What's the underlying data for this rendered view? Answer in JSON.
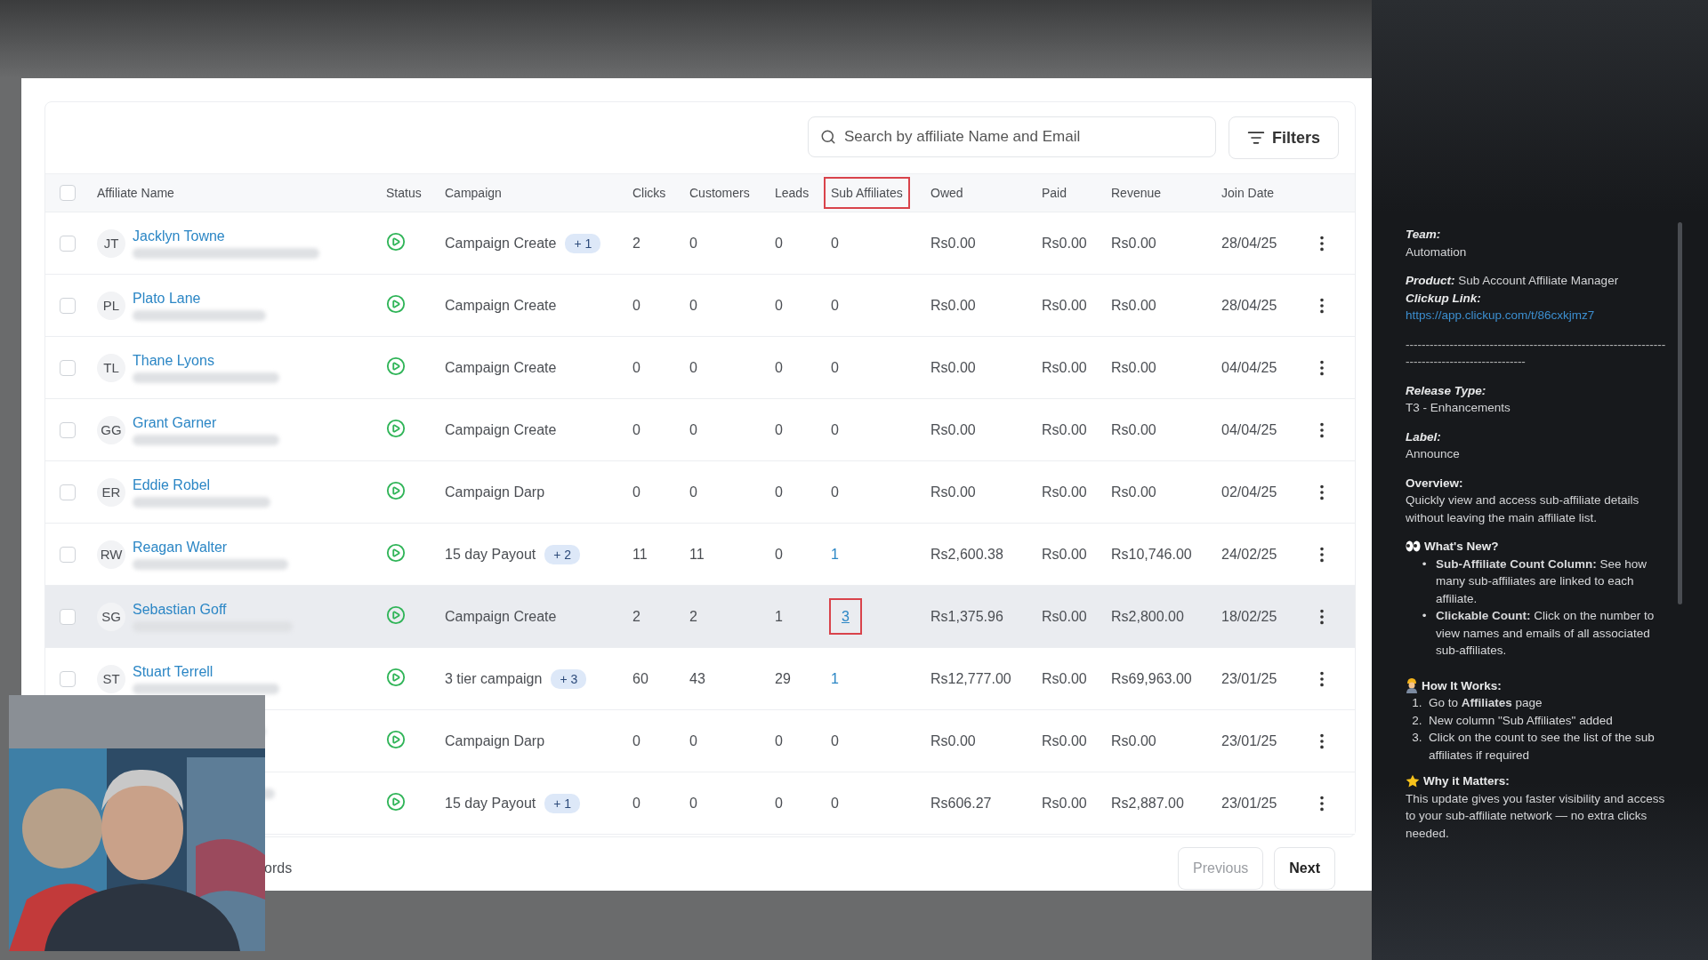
{
  "search": {
    "placeholder": "Search by affiliate Name and Email"
  },
  "filters_button": "Filters",
  "table": {
    "select_all_checked": false,
    "columns": [
      {
        "label": "Affiliate Name",
        "highlighted": false
      },
      {
        "label": "Status",
        "highlighted": false
      },
      {
        "label": "Campaign",
        "highlighted": false
      },
      {
        "label": "Clicks",
        "highlighted": false
      },
      {
        "label": "Customers",
        "highlighted": false
      },
      {
        "label": "Leads",
        "highlighted": false
      },
      {
        "label": "Sub Affiliates",
        "highlighted": true
      },
      {
        "label": "Owed",
        "highlighted": false
      },
      {
        "label": "Paid",
        "highlighted": false
      },
      {
        "label": "Revenue",
        "highlighted": false
      },
      {
        "label": "Join Date",
        "highlighted": false
      }
    ],
    "rows": [
      {
        "selected": false,
        "checked": false,
        "initials": "JT",
        "name": "Jacklyn Towne",
        "campaign": "Campaign Create",
        "campaign_extra": "+ 1",
        "clicks": "2",
        "customers": "0",
        "leads": "0",
        "sub_affiliates": "0",
        "sub_link": false,
        "sub_highlighted": false,
        "owed": "Rs0.00",
        "paid": "Rs0.00",
        "revenue": "Rs0.00",
        "join_date": "28/04/25"
      },
      {
        "selected": false,
        "checked": false,
        "initials": "PL",
        "name": "Plato Lane",
        "campaign": "Campaign Create",
        "clicks": "0",
        "customers": "0",
        "leads": "0",
        "sub_affiliates": "0",
        "sub_link": false,
        "sub_highlighted": false,
        "owed": "Rs0.00",
        "paid": "Rs0.00",
        "revenue": "Rs0.00",
        "join_date": "28/04/25"
      },
      {
        "selected": false,
        "checked": false,
        "initials": "TL",
        "name": "Thane Lyons",
        "campaign": "Campaign Create",
        "clicks": "0",
        "customers": "0",
        "leads": "0",
        "sub_affiliates": "0",
        "sub_link": false,
        "sub_highlighted": false,
        "owed": "Rs0.00",
        "paid": "Rs0.00",
        "revenue": "Rs0.00",
        "join_date": "04/04/25"
      },
      {
        "selected": false,
        "checked": false,
        "initials": "GG",
        "name": "Grant Garner",
        "campaign": "Campaign Create",
        "clicks": "0",
        "customers": "0",
        "leads": "0",
        "sub_affiliates": "0",
        "sub_link": false,
        "sub_highlighted": false,
        "owed": "Rs0.00",
        "paid": "Rs0.00",
        "revenue": "Rs0.00",
        "join_date": "04/04/25"
      },
      {
        "selected": false,
        "checked": false,
        "initials": "ER",
        "name": "Eddie Robel",
        "campaign": "Campaign Darp",
        "clicks": "0",
        "customers": "0",
        "leads": "0",
        "sub_affiliates": "0",
        "sub_link": false,
        "sub_highlighted": false,
        "owed": "Rs0.00",
        "paid": "Rs0.00",
        "revenue": "Rs0.00",
        "join_date": "02/04/25"
      },
      {
        "selected": false,
        "checked": false,
        "initials": "RW",
        "name": "Reagan Walter",
        "campaign": "15 day Payout",
        "campaign_extra": "+ 2",
        "clicks": "11",
        "customers": "11",
        "leads": "0",
        "sub_affiliates": "1",
        "sub_link": true,
        "sub_highlighted": false,
        "owed": "Rs2,600.38",
        "paid": "Rs0.00",
        "revenue": "Rs10,746.00",
        "join_date": "24/02/25"
      },
      {
        "selected": true,
        "checked": false,
        "initials": "SG",
        "name": "Sebastian Goff",
        "campaign": "Campaign Create",
        "clicks": "2",
        "customers": "2",
        "leads": "1",
        "sub_affiliates": "3",
        "sub_link": true,
        "sub_highlighted": true,
        "owed": "Rs1,375.96",
        "paid": "Rs0.00",
        "revenue": "Rs2,800.00",
        "join_date": "18/02/25"
      },
      {
        "selected": false,
        "checked": false,
        "initials": "ST",
        "name": "Stuart Terrell",
        "campaign": "3 tier campaign",
        "campaign_extra": "+ 3",
        "clicks": "60",
        "customers": "43",
        "leads": "29",
        "sub_affiliates": "1",
        "sub_link": true,
        "sub_highlighted": false,
        "owed": "Rs12,777.00",
        "paid": "Rs0.00",
        "revenue": "Rs69,963.00",
        "join_date": "23/01/25"
      },
      {
        "selected": false,
        "campaign": "Campaign Darp",
        "clicks": "0",
        "customers": "0",
        "leads": "0",
        "sub_affiliates": "0",
        "sub_link": false,
        "sub_highlighted": false,
        "owed": "Rs0.00",
        "paid": "Rs0.00",
        "revenue": "Rs0.00",
        "join_date": "23/01/25"
      },
      {
        "selected": false,
        "campaign": "15 day Payout",
        "campaign_extra": "+ 1",
        "clicks": "0",
        "customers": "0",
        "leads": "0",
        "sub_affiliates": "0",
        "sub_link": false,
        "sub_highlighted": false,
        "owed": "Rs606.27",
        "paid": "Rs0.00",
        "revenue": "Rs2,887.00",
        "join_date": "23/01/25"
      }
    ]
  },
  "footer": {
    "records_text": "ords",
    "buttons": [
      {
        "label": "Previous",
        "disabled": true
      },
      {
        "label": "Next",
        "disabled": false
      }
    ]
  },
  "notes": [
    {
      "kind": "field",
      "label": "Team:",
      "value": "Automation"
    },
    {
      "kind": "inline",
      "label": "Product:",
      "value": "Sub Account Affiliate Manager"
    },
    {
      "kind": "link",
      "label": "Clickup Link:",
      "value": "https://app.clickup.com/t/86cxkjmz7"
    },
    {
      "kind": "rule",
      "text": "-----------------------------------------------------------------------------------------------"
    },
    {
      "kind": "field",
      "label": "Release Type:",
      "value": "T3 - Enhancements"
    },
    {
      "kind": "field",
      "label": "Label:",
      "value": "Announce"
    },
    {
      "kind": "heading",
      "label": "Overview:",
      "value": "Quickly view and access sub-affiliate details without leaving the main affiliate list."
    },
    {
      "kind": "bullets",
      "title": "What's New?",
      "items": [
        {
          "bullet": "•",
          "text": "**Sub-Affiliate Count Column:** See how many sub-affiliates are linked to each affiliate."
        },
        {
          "bullet": "•",
          "text": "**Clickable Count:** Click on the number to view names and emails of all associated sub-affiliates."
        }
      ]
    },
    {
      "kind": "numbered",
      "title": "How It Works:",
      "items": [
        {
          "bullet": "1.",
          "text": "Go to **Affiliates** page"
        },
        {
          "bullet": "2.",
          "text": "New column \"Sub Affiliates\" added"
        },
        {
          "bullet": "3.",
          "text": "Click on the count to see the list of the sub affiliates if required"
        }
      ]
    },
    {
      "kind": "paragraph",
      "title": "Why it Matters:",
      "value": "This update gives you faster visibility and access to your sub-affiliate network — no extra clicks needed."
    }
  ]
}
